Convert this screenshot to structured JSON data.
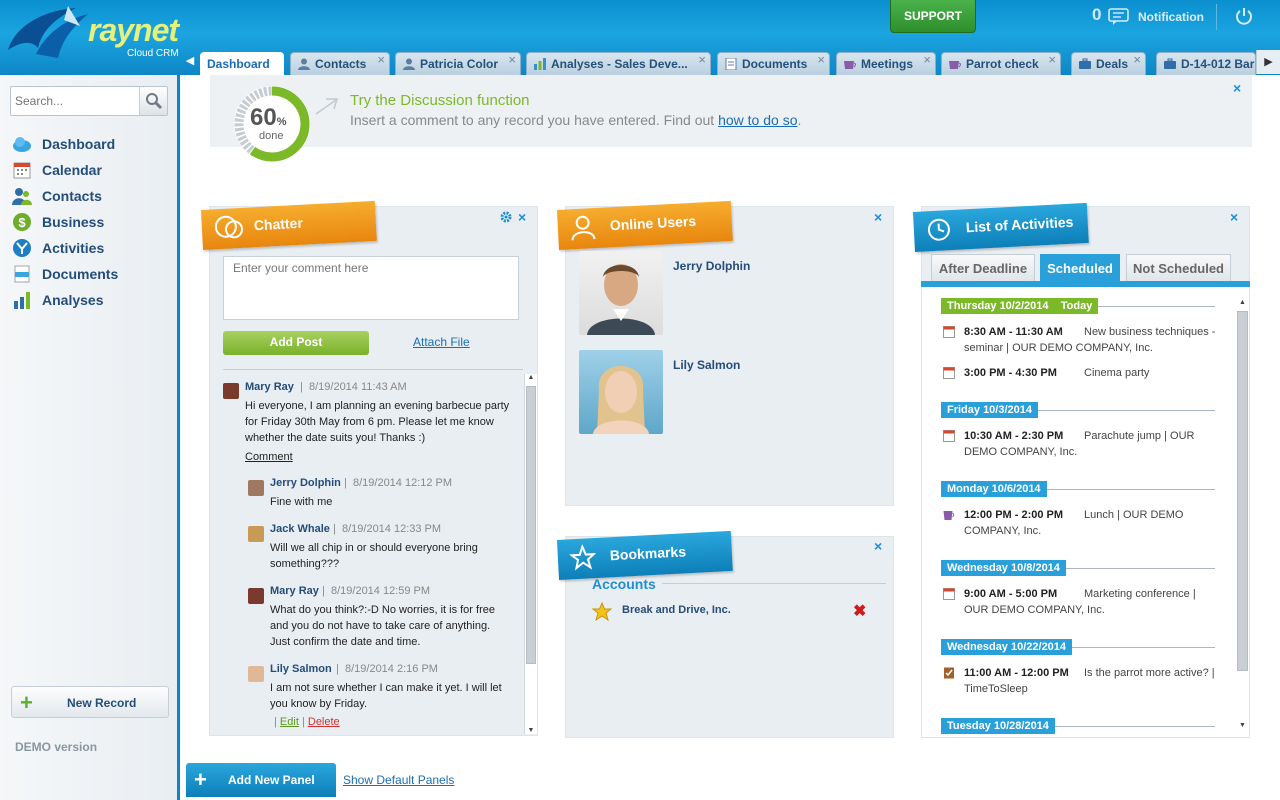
{
  "app": {
    "logo_text": "raynet",
    "logo_sub": "Cloud CRM"
  },
  "header": {
    "support_label": "SUPPORT",
    "notification_count": "0",
    "notification_label": "Notification"
  },
  "tabs": [
    {
      "label": "Dashboard",
      "icon": "dashboard",
      "active": true
    },
    {
      "label": "Contacts",
      "icon": "person-icon"
    },
    {
      "label": "Patricia Color",
      "icon": "person-icon"
    },
    {
      "label": "Analyses - Sales Deve...",
      "icon": "chart-icon"
    },
    {
      "label": "Documents",
      "icon": "document-icon"
    },
    {
      "label": "Meetings",
      "icon": "cup-icon"
    },
    {
      "label": "Parrot check",
      "icon": "cup-icon"
    },
    {
      "label": "Deals",
      "icon": "briefcase-icon"
    },
    {
      "label": "D-14-012 Bar",
      "icon": "briefcase-icon"
    }
  ],
  "sidebar": {
    "search_placeholder": "Search...",
    "items": [
      {
        "label": "Dashboard",
        "icon": "cloud-icon"
      },
      {
        "label": "Calendar",
        "icon": "calendar-icon"
      },
      {
        "label": "Contacts",
        "icon": "contacts-icon"
      },
      {
        "label": "Business",
        "icon": "dollar-icon"
      },
      {
        "label": "Activities",
        "icon": "activities-icon"
      },
      {
        "label": "Documents",
        "icon": "documents-icon"
      },
      {
        "label": "Analyses",
        "icon": "analyses-icon"
      }
    ],
    "new_record": "New Record",
    "demo": "DEMO version"
  },
  "banner": {
    "percent": "60",
    "percent_sign": "%",
    "done": "done",
    "progress": 0.6,
    "title": "Try the Discussion function",
    "text": "Insert a comment to any record you have entered. Find out ",
    "link": "how to do so",
    "tail": "."
  },
  "chatter": {
    "title": "Chatter",
    "input_placeholder": "Enter your comment here",
    "add_post": "Add Post",
    "attach_file": "Attach File",
    "comment_link": "Comment",
    "edit": "Edit",
    "delete": "Delete",
    "posts": [
      {
        "author": "Mary Ray",
        "date": "8/19/2014 11:43 AM",
        "text": "Hi everyone, I am planning an evening barbecue party for Friday 30th May from 6 pm. Please let me know whether the date suits you! Thanks :)"
      },
      {
        "author": "Jerry Dolphin",
        "date": "8/19/2014 12:12 PM",
        "text": "Fine with me"
      },
      {
        "author": "Jack Whale",
        "date": "8/19/2014 12:33 PM",
        "text": "Will we all chip in or should everyone bring something???"
      },
      {
        "author": "Mary Ray",
        "date": "8/19/2014 12:59 PM",
        "text": "What do you think?:-D No worries, it is for free and you do not have to take care of anything. Just confirm the date and time."
      },
      {
        "author": "Lily Salmon",
        "date": "8/19/2014 2:16 PM",
        "text": "I am not sure whether I can make it yet. I will let you know by Friday."
      }
    ]
  },
  "online": {
    "title": "Online Users",
    "users": [
      {
        "name": "Jerry Dolphin"
      },
      {
        "name": "Lily Salmon"
      }
    ]
  },
  "bookmarks": {
    "title": "Bookmarks",
    "section": "Accounts",
    "items": [
      {
        "label": "Break and Drive, Inc."
      }
    ]
  },
  "activities": {
    "title": "List of Activities",
    "tabs": [
      "After Deadline",
      "Scheduled",
      "Not Scheduled"
    ],
    "active_tab": "Scheduled",
    "days": [
      {
        "label": "Thursday 10/2/2014",
        "today": "Today",
        "items": [
          {
            "time": "8:30 AM - 11:30 AM",
            "desc": "New business techniques - seminar | OUR DEMO COMPANY, Inc.",
            "icon": "calendar-icon"
          },
          {
            "time": "3:00 PM - 4:30 PM",
            "desc": "Cinema party",
            "icon": "calendar-icon"
          }
        ]
      },
      {
        "label": "Friday 10/3/2014",
        "items": [
          {
            "time": "10:30 AM - 2:30 PM",
            "desc": "Parachute jump | OUR DEMO COMPANY, Inc.",
            "icon": "calendar-icon"
          }
        ]
      },
      {
        "label": "Monday 10/6/2014",
        "items": [
          {
            "time": "12:00 PM - 2:00 PM",
            "desc": "Lunch | OUR DEMO COMPANY, Inc.",
            "icon": "cup-icon"
          }
        ]
      },
      {
        "label": "Wednesday 10/8/2014",
        "items": [
          {
            "time": "9:00 AM - 5:00 PM",
            "desc": "Marketing conference | OUR DEMO COMPANY, Inc.",
            "icon": "calendar-icon"
          }
        ]
      },
      {
        "label": "Wednesday 10/22/2014",
        "items": [
          {
            "time": "11:00 AM - 12:00 PM",
            "desc": "Is the parrot more active? | TimeToSleep",
            "icon": "task-icon"
          }
        ]
      },
      {
        "label": "Tuesday 10/28/2014",
        "items": []
      }
    ]
  },
  "footer": {
    "add_panel": "Add New Panel",
    "default_panels": "Show Default Panels"
  },
  "colors": {
    "brand_blue": "#0e86c6",
    "accent_orange": "#f29a1f",
    "accent_green": "#7cb928",
    "link": "#1a6db4"
  }
}
